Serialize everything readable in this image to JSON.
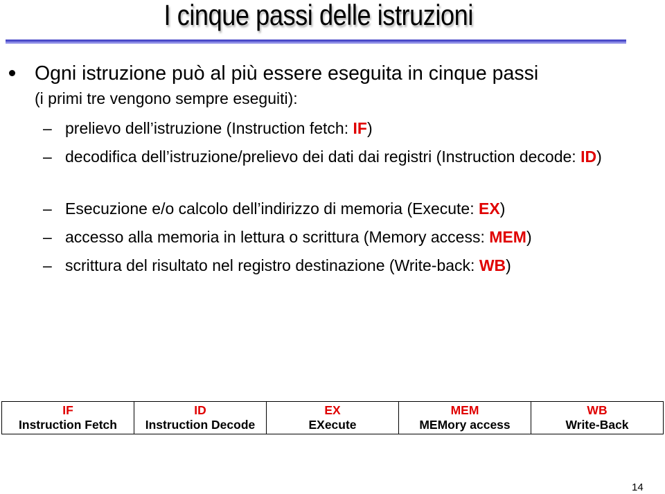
{
  "slide": {
    "title": "I cinque passi delle istruzioni",
    "page_number": "14",
    "colors": {
      "accent_red": "#e00000",
      "rule_dark": "#4a4ac8",
      "rule_light": "#8c8ce6"
    }
  },
  "bullet": {
    "icon": "bullet-dot-icon",
    "line1": "Ogni istruzione può al più essere eseguita in cinque passi",
    "line2": "(i primi tre vengono sempre eseguiti):"
  },
  "sub_items": [
    {
      "dash": "–",
      "prefix": "prelievo dell’istruzione (Instruction fetch: ",
      "highlight": "IF",
      "suffix": ")"
    },
    {
      "dash": "–",
      "prefix": "decodifica dell’istruzione/prelievo dei dati dai registri (Instruction decode: ",
      "highlight": "ID",
      "suffix": ")"
    },
    {
      "dash": "–",
      "prefix": "Esecuzione e/o calcolo dell’indirizzo di memoria (Execute: ",
      "highlight": "EX",
      "suffix": ")"
    },
    {
      "dash": "–",
      "prefix": "accesso alla memoria in lettura o scrittura (Memory access: ",
      "highlight": "MEM",
      "suffix": ")"
    },
    {
      "dash": "–",
      "prefix": "scrittura del risultato nel registro destinazione (Write-back: ",
      "highlight": "WB",
      "suffix": ")"
    }
  ],
  "pipeline": [
    {
      "abbr": "IF",
      "label": "Instruction Fetch"
    },
    {
      "abbr": "ID",
      "label": "Instruction Decode"
    },
    {
      "abbr": "EX",
      "label": "EXecute"
    },
    {
      "abbr": "MEM",
      "label": "MEMory access"
    },
    {
      "abbr": "WB",
      "label": "Write-Back"
    }
  ]
}
